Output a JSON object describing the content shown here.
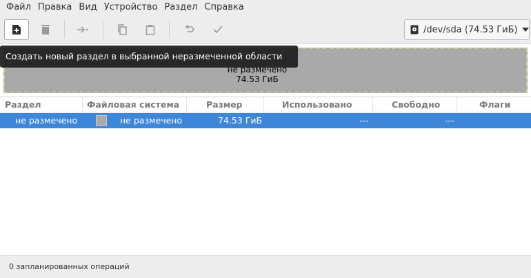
{
  "menubar": {
    "items": [
      "Файл",
      "Правка",
      "Вид",
      "Устройство",
      "Раздел",
      "Справка"
    ]
  },
  "toolbar": {
    "buttons": [
      {
        "icon": "new-partition-icon",
        "state": "active"
      },
      {
        "icon": "delete-icon",
        "state": "disabled"
      },
      {
        "icon": "resize-move-icon",
        "state": "disabled"
      },
      {
        "icon": "copy-icon",
        "state": "disabled"
      },
      {
        "icon": "paste-icon",
        "state": "disabled"
      },
      {
        "icon": "undo-icon",
        "state": "disabled"
      },
      {
        "icon": "apply-icon",
        "state": "disabled"
      }
    ],
    "device": "/dev/sda (74.53 ГиБ)"
  },
  "tooltip": {
    "text": "Создать новый раздел в выбранной неразмеченной области"
  },
  "disk_graphic": {
    "name": "не размечено",
    "size": "74.53 ГиБ",
    "fill_color": "#a9a9a9"
  },
  "table": {
    "columns": [
      "Раздел",
      "Файловая система",
      "Размер",
      "Использовано",
      "Свободно",
      "Флаги"
    ],
    "rows": [
      {
        "partition": "не размечено",
        "filesystem": "не размечено",
        "size": "74.53 ГиБ",
        "used": "---",
        "free": "---",
        "flags": "",
        "selected": true
      }
    ],
    "selection_color": "#3d86d8"
  },
  "status": {
    "text": "0 запланированных операций"
  }
}
